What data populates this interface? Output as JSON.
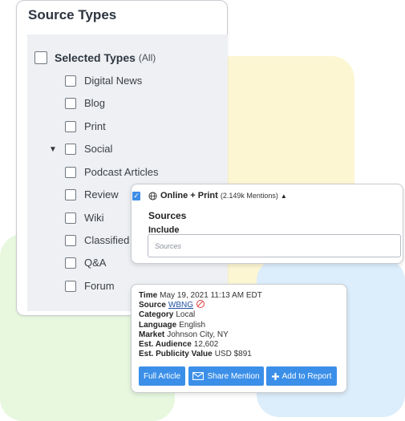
{
  "source_types": {
    "title": "Source Types",
    "selected": {
      "label": "Selected Types",
      "sub": "(All)"
    },
    "items": [
      {
        "label": "Digital News"
      },
      {
        "label": "Blog"
      },
      {
        "label": "Print"
      },
      {
        "label": "Social"
      },
      {
        "label": "Podcast Articles"
      },
      {
        "label": "Review"
      },
      {
        "label": "Wiki"
      },
      {
        "label": "Classified"
      },
      {
        "label": "Q&A"
      },
      {
        "label": "Forum"
      }
    ]
  },
  "online_print": {
    "label": "Online + Print",
    "count": "(2.149k Mentions)",
    "sources_title": "Sources",
    "include_label": "Include",
    "input_placeholder": "Sources"
  },
  "mention": {
    "time_label": "Time",
    "time_value": "May 19, 2021 11:13 AM EDT",
    "source_label": "Source",
    "source_value": "WBNG",
    "category_label": "Category",
    "category_value": "Local",
    "language_label": "Language",
    "language_value": "English",
    "market_label": "Market",
    "market_value": "Johnson City, NY",
    "audience_label": "Est. Audience",
    "audience_value": "12,602",
    "publicity_label": "Est. Publicity Value",
    "publicity_value": "USD $891",
    "buttons": {
      "full_article": "Full Article",
      "share_mention": "Share Mention",
      "add_to_report": "Add to Report"
    }
  },
  "colors": {
    "accent_blue": "#3b8fe8",
    "yellow_blob": "#fdf6d3",
    "green_blob": "#e7f8df",
    "blue_blob": "#dcedfb"
  }
}
